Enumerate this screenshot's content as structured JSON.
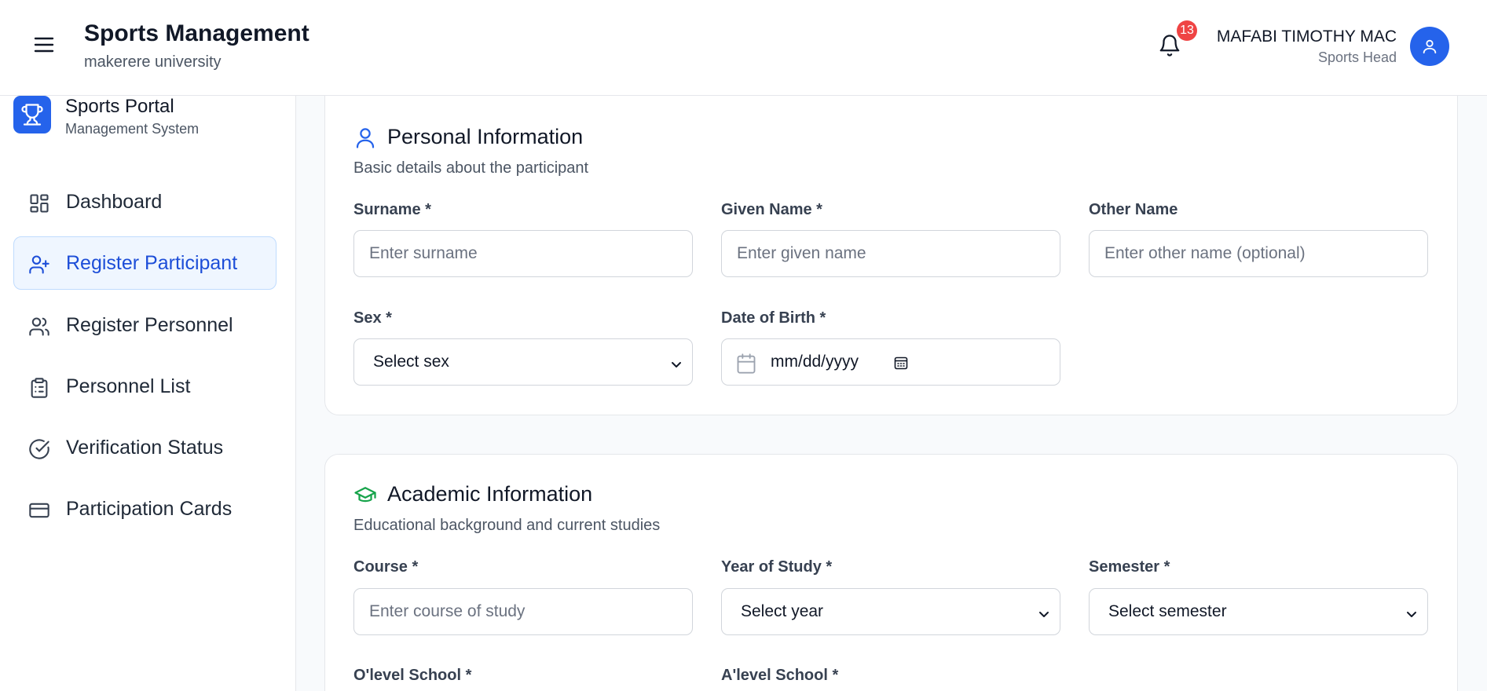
{
  "header": {
    "title": "Sports Management",
    "subtitle": "makerere university",
    "notification_count": "13",
    "user_name": "MAFABI TIMOTHY MAC",
    "user_role": "Sports Head"
  },
  "sidebar": {
    "brand_title": "Sports Portal",
    "brand_subtitle": "Management System",
    "items": [
      {
        "label": "Dashboard",
        "icon": "dashboard-icon"
      },
      {
        "label": "Register Participant",
        "icon": "user-plus-icon",
        "active": true
      },
      {
        "label": "Register Personnel",
        "icon": "users-icon"
      },
      {
        "label": "Personnel List",
        "icon": "clipboard-list-icon"
      },
      {
        "label": "Verification Status",
        "icon": "check-circle-icon"
      },
      {
        "label": "Participation Cards",
        "icon": "credit-card-icon"
      }
    ]
  },
  "personal": {
    "title": "Personal Information",
    "description": "Basic details about the participant",
    "surname_label": "Surname *",
    "surname_placeholder": "Enter surname",
    "given_label": "Given Name *",
    "given_placeholder": "Enter given name",
    "other_label": "Other Name",
    "other_placeholder": "Enter other name (optional)",
    "sex_label": "Sex *",
    "sex_value": "Select sex",
    "dob_label": "Date of Birth *",
    "dob_placeholder": "mm/dd/yyyy"
  },
  "academic": {
    "title": "Academic Information",
    "description": "Educational background and current studies",
    "course_label": "Course *",
    "course_placeholder": "Enter course of study",
    "year_label": "Year of Study *",
    "year_value": "Select year",
    "semester_label": "Semester *",
    "semester_value": "Select semester",
    "olevel_label": "O'level School *",
    "alevel_label": "A'level School *"
  },
  "colors": {
    "primary": "#2563eb",
    "badge": "#ef4444",
    "academic_icon": "#16a34a"
  }
}
